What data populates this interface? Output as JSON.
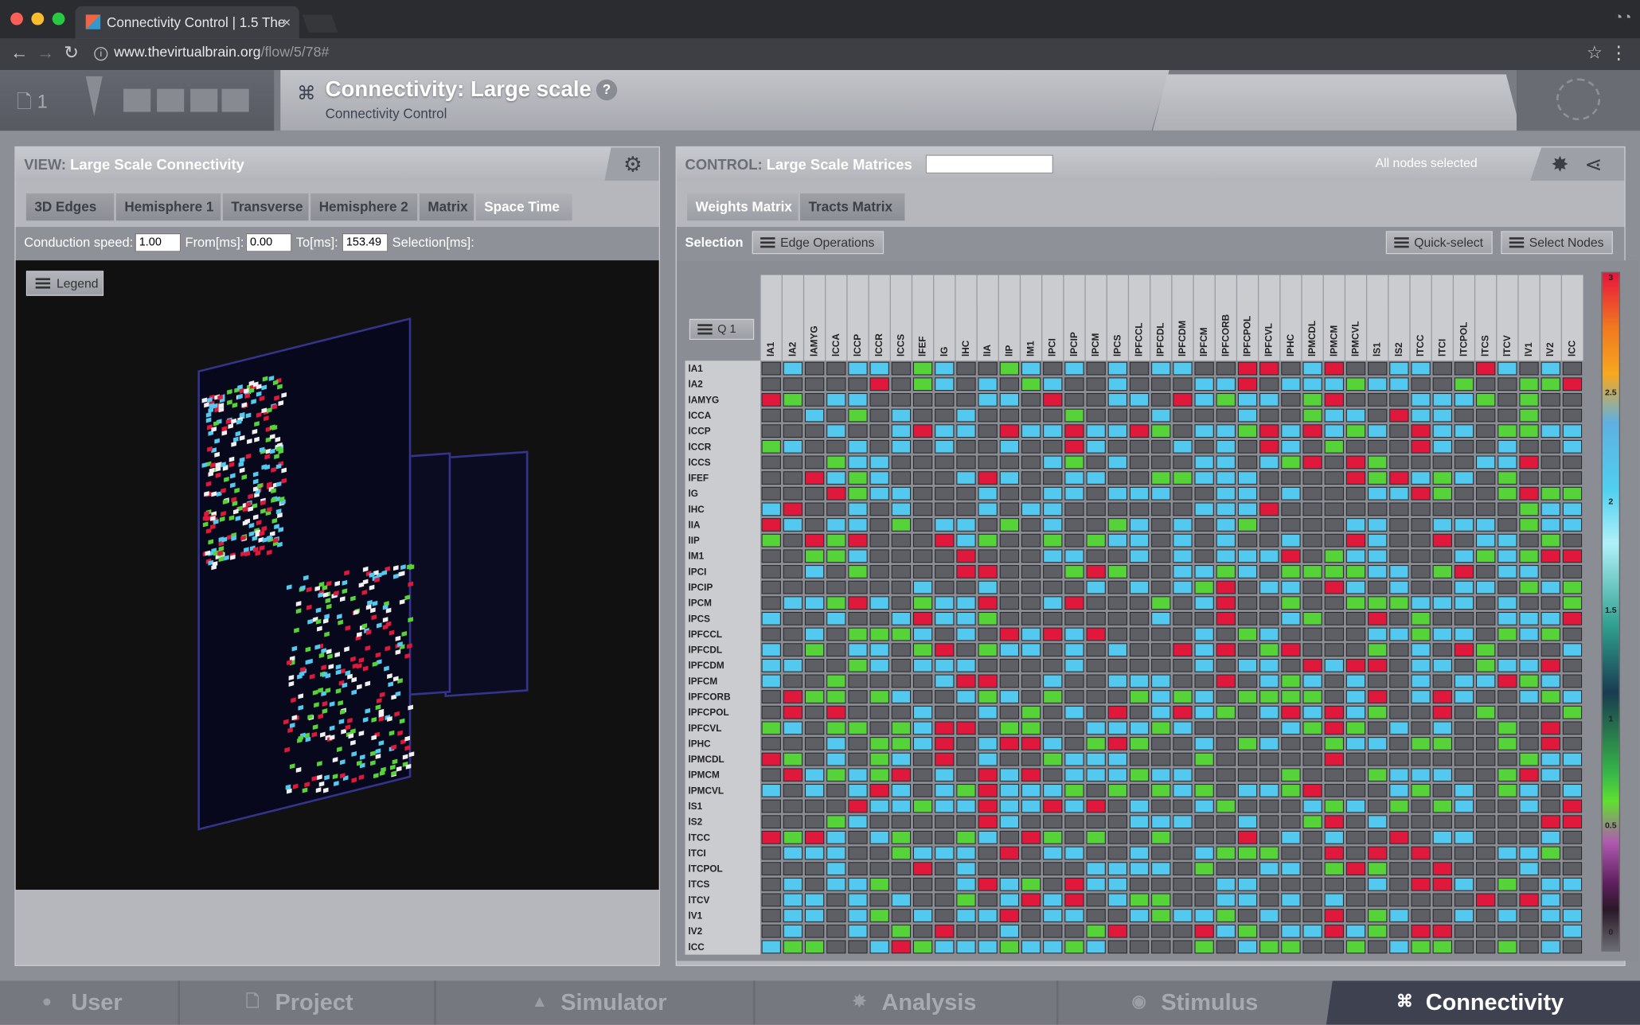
{
  "browser": {
    "tab_title": "Connectivity Control | 1.5 The",
    "tab_close": "×",
    "url_host": "www.thevirtualbrain.org",
    "url_path": "/flow/5/78#"
  },
  "header": {
    "project_number": "1",
    "title": "Connectivity: Large scale",
    "help": "?",
    "subtitle": "Connectivity Control"
  },
  "view_panel": {
    "label_prefix": "VIEW:",
    "label": "Large Scale Connectivity",
    "tabs": [
      "3D Edges",
      "Hemisphere 1",
      "Transverse",
      "Hemisphere 2",
      "Matrix",
      "Space Time"
    ],
    "active_tab": "Space Time",
    "conduction_label": "Conduction speed:",
    "conduction_value": "1.00",
    "from_label": "From[ms]:",
    "from_value": "0.00",
    "to_label": "To[ms]:",
    "to_value": "153.49",
    "selection_label": "Selection[ms]:",
    "legend_button": "Legend"
  },
  "control_panel": {
    "label_prefix": "CONTROL:",
    "label": "Large Scale Matrices",
    "nodes_status": "All nodes selected",
    "tabs": [
      "Weights Matrix",
      "Tracts Matrix"
    ],
    "active_tab": "Weights Matrix",
    "selection_label": "Selection",
    "edge_ops_button": "Edge Operations",
    "quick_select_button": "Quick-select",
    "select_nodes_button": "Select Nodes",
    "quadrant_button": "Q 1",
    "nodes": [
      "lA1",
      "lA2",
      "lAMYG",
      "lCCA",
      "lCCP",
      "lCCR",
      "lCCS",
      "lFEF",
      "lG",
      "lHC",
      "lIA",
      "lIP",
      "lM1",
      "lPCI",
      "lPCIP",
      "lPCM",
      "lPCS",
      "lPFCCL",
      "lPFCDL",
      "lPFCDM",
      "lPFCM",
      "lPFCORB",
      "lPFCPOL",
      "lPFCVL",
      "lPHC",
      "lPMCDL",
      "lPMCM",
      "lPMCVL",
      "lS1",
      "lS2",
      "lTCC",
      "lTCI",
      "lTCPOL",
      "lTCS",
      "lTCV",
      "lV1",
      "lV2",
      "lCC"
    ],
    "colorbar_labels": [
      "3",
      "2.5",
      "2",
      "1.5",
      "1",
      "0.5",
      "0"
    ],
    "colors": {
      "zero": "#5d5f64",
      "low": "#53c9f0",
      "mid": "#57d33a",
      "high": "#e0183b"
    }
  },
  "bottom_nav": [
    "User",
    "Project",
    "Simulator",
    "Analysis",
    "Stimulus",
    "Connectivity"
  ],
  "bottom_nav_active": "Connectivity"
}
